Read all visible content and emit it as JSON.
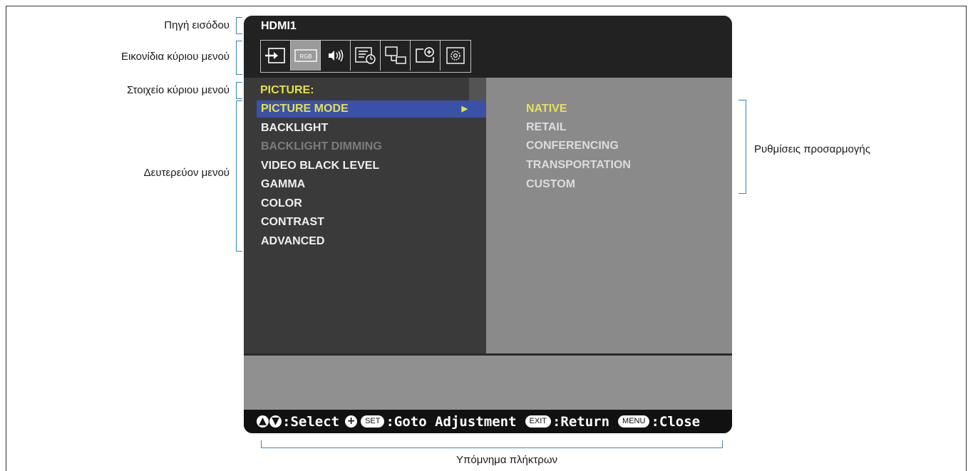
{
  "annotations": {
    "input_source": "Πηγή εισόδου",
    "main_menu_icons": "Εικονίδια κύριου μενού",
    "main_menu_item": "Στοιχείο κύριου μενού",
    "sub_menu": "Δευτερεύον μενού",
    "adjustment_settings": "Ρυθμίσεις προσαρμογής",
    "key_legend": "Υπόμνημα πλήκτρων"
  },
  "osd": {
    "input_source": "HDMI1",
    "main_menu_icons": [
      "input-icon",
      "rgb-picture-icon",
      "audio-icon",
      "schedule-icon",
      "multi-input-icon",
      "protect-icon",
      "settings-icon"
    ],
    "rgb_icon_text": "RGB",
    "selected_icon": "rgb-picture-icon",
    "main_menu_title": "PICTURE:",
    "sub_menu": [
      {
        "label": "PICTURE MODE",
        "state": "active"
      },
      {
        "label": "BACKLIGHT",
        "state": "normal"
      },
      {
        "label": "BACKLIGHT DIMMING",
        "state": "disabled"
      },
      {
        "label": "VIDEO BLACK LEVEL",
        "state": "normal"
      },
      {
        "label": "GAMMA",
        "state": "normal"
      },
      {
        "label": "COLOR",
        "state": "normal"
      },
      {
        "label": "CONTRAST",
        "state": "normal"
      },
      {
        "label": "ADVANCED",
        "state": "normal"
      }
    ],
    "adjustment_options": [
      "NATIVE",
      "RETAIL",
      "CONFERENCING",
      "TRANSPORTATION",
      "CUSTOM"
    ],
    "selected_option": "NATIVE",
    "footer": {
      "select": ":Select",
      "set_key": "SET",
      "goto": ":Goto Adjustment",
      "exit_key": "EXIT",
      "return": ":Return",
      "menu_key": "MENU",
      "close": ":Close"
    }
  },
  "colors": {
    "highlight_yellow": "#e5e04a",
    "selection_blue": "#3b51a8",
    "bracket_blue": "#3a86b8"
  }
}
